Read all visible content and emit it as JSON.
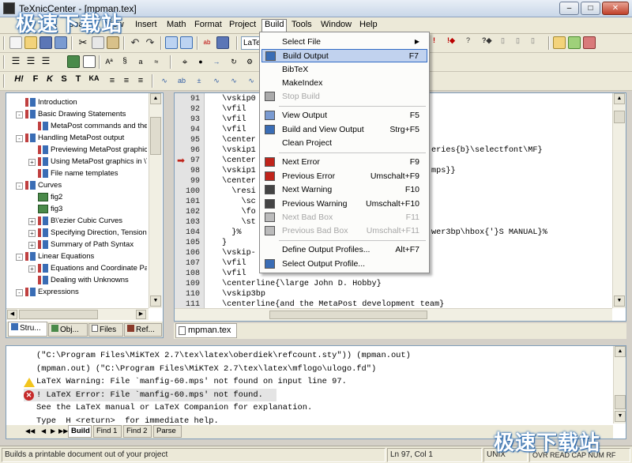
{
  "window": {
    "title": "TeXnicCenter - [mpman.tex]"
  },
  "menubar": {
    "items": [
      "File",
      "Edit",
      "Search",
      "View",
      "Insert",
      "Math",
      "Format",
      "Project",
      "Build",
      "Tools",
      "Window",
      "Help"
    ]
  },
  "toolbar": {
    "combo_text": "LaTe",
    "format_buttons": [
      "H!",
      "F",
      "K",
      "S",
      "T",
      "KA"
    ]
  },
  "watermark": {
    "text": "极速下载站"
  },
  "build_menu": {
    "items": [
      {
        "label": "Select File",
        "shortcut": "",
        "submenu": true,
        "enabled": true
      },
      {
        "label": "Build Output",
        "shortcut": "F7",
        "enabled": true,
        "highlighted": true
      },
      {
        "label": "BibTeX",
        "shortcut": "",
        "enabled": true
      },
      {
        "label": "MakeIndex",
        "shortcut": "",
        "enabled": true
      },
      {
        "label": "Stop Build",
        "shortcut": "",
        "enabled": false
      },
      {
        "label": "View Output",
        "shortcut": "F5",
        "enabled": true
      },
      {
        "label": "Build and View Output",
        "shortcut": "Strg+F5",
        "enabled": true
      },
      {
        "label": "Clean Project",
        "shortcut": "",
        "enabled": true
      },
      {
        "label": "Next Error",
        "shortcut": "F9",
        "enabled": true
      },
      {
        "label": "Previous Error",
        "shortcut": "Umschalt+F9",
        "enabled": true
      },
      {
        "label": "Next Warning",
        "shortcut": "F10",
        "enabled": true
      },
      {
        "label": "Previous Warning",
        "shortcut": "Umschalt+F10",
        "enabled": true
      },
      {
        "label": "Next Bad Box",
        "shortcut": "F11",
        "enabled": false
      },
      {
        "label": "Previous Bad Box",
        "shortcut": "Umschalt+F11",
        "enabled": false
      },
      {
        "label": "Define Output Profiles...",
        "shortcut": "Alt+F7",
        "enabled": true
      },
      {
        "label": "Select Output Profile...",
        "shortcut": "",
        "enabled": true
      }
    ]
  },
  "tree": {
    "items": [
      {
        "label": "Introduction",
        "level": 1,
        "expander": "",
        "icon": "section-icon"
      },
      {
        "label": "Basic Drawing Statements",
        "level": 1,
        "expander": "-",
        "icon": "section-icon"
      },
      {
        "label": "MetaPost commands and the re",
        "level": 2,
        "expander": "",
        "icon": "subsection-icon"
      },
      {
        "label": "Handling MetaPost output",
        "level": 1,
        "expander": "-",
        "icon": "section-icon"
      },
      {
        "label": "Previewing MetaPost graphics",
        "level": 2,
        "expander": "",
        "icon": "subsection-icon"
      },
      {
        "label": "Using MetaPost graphics in \\Te",
        "level": 2,
        "expander": "+",
        "icon": "subsection-icon"
      },
      {
        "label": "File name templates",
        "level": 2,
        "expander": "",
        "icon": "subsection-icon"
      },
      {
        "label": "Curves",
        "level": 1,
        "expander": "-",
        "icon": "section-icon"
      },
      {
        "label": "fig2",
        "level": 2,
        "expander": "",
        "icon": "figure-icon"
      },
      {
        "label": "fig3",
        "level": 2,
        "expander": "",
        "icon": "figure-icon"
      },
      {
        "label": "B\\'ezier Cubic Curves",
        "level": 2,
        "expander": "+",
        "icon": "subsection-icon"
      },
      {
        "label": "Specifying Direction, Tension, a",
        "level": 2,
        "expander": "+",
        "icon": "subsection-icon"
      },
      {
        "label": "Summary of Path Syntax",
        "level": 2,
        "expander": "+",
        "icon": "subsection-icon"
      },
      {
        "label": "Linear Equations",
        "level": 1,
        "expander": "-",
        "icon": "section-icon"
      },
      {
        "label": "Equations and Coordinate Pairs",
        "level": 2,
        "expander": "+",
        "icon": "subsection-icon"
      },
      {
        "label": "Dealing with Unknowns",
        "level": 2,
        "expander": "",
        "icon": "subsection-icon"
      },
      {
        "label": "Expressions",
        "level": 1,
        "expander": "-",
        "icon": "section-icon"
      }
    ]
  },
  "left_tabs": [
    "Stru...",
    "Obj...",
    "Files",
    "Ref..."
  ],
  "editor": {
    "tab_label": "mpman.tex",
    "lines": [
      {
        "n": "91",
        "text": "\\vskip0"
      },
      {
        "n": "92",
        "text": "\\vfil"
      },
      {
        "n": "93",
        "text": "\\vfil"
      },
      {
        "n": "94",
        "text": "\\vfil"
      },
      {
        "n": "95",
        "text": "\\center"
      },
      {
        "n": "96",
        "text": "\\vskip1"
      },
      {
        "n": "97",
        "text": "\\center"
      },
      {
        "n": "98",
        "text": "\\vskip1"
      },
      {
        "n": "99",
        "text": "\\center"
      },
      {
        "n": "100",
        "text": "  \\resi"
      },
      {
        "n": "101",
        "text": "    \\sc"
      },
      {
        "n": "102",
        "text": "    \\fo"
      },
      {
        "n": "103",
        "text": "    \\st"
      },
      {
        "n": "104",
        "text": "  }%"
      },
      {
        "n": "105",
        "text": "}"
      },
      {
        "n": "106",
        "text": "\\vskip-"
      },
      {
        "n": "107",
        "text": "\\vfil"
      },
      {
        "n": "108",
        "text": "\\vfil"
      },
      {
        "n": "109",
        "text": "\\centerline{\\large John D. Hobby}"
      },
      {
        "n": "110",
        "text": "\\vskip3bp"
      },
      {
        "n": "111",
        "text": "\\centerline{and the MetaPost development team}"
      }
    ],
    "right_fragments": [
      {
        "line": 5,
        "text": "eries{b}\\selectfont\\MF}"
      },
      {
        "line": 7,
        "text": "mps}}"
      },
      {
        "line": 13,
        "text": "wer3bp\\hbox{'}S MANUAL}%"
      }
    ]
  },
  "output": {
    "lines": [
      {
        "text": "(\"C:\\Program Files\\MiKTeX 2.7\\tex\\latex\\oberdiek\\refcount.sty\")) (mpman.out)",
        "icon": ""
      },
      {
        "text": "(mpman.out) (\"C:\\Program Files\\MiKTeX 2.7\\tex\\latex\\mflogo\\ulogo.fd\")",
        "icon": ""
      },
      {
        "text": "LaTeX Warning: File `manfig-60.mps' not found on input line 97.",
        "icon": "warning"
      },
      {
        "text": "! LaTeX Error: File `manfig-60.mps' not found.",
        "icon": "error"
      },
      {
        "text": "See the LaTeX manual or LaTeX Companion for explanation.",
        "icon": ""
      },
      {
        "text": "Type  H <return>  for immediate help.",
        "icon": ""
      }
    ],
    "tabs": [
      "Build",
      "Find 1",
      "Find 2",
      "Parse"
    ]
  },
  "statusbar": {
    "message": "Builds a printable document out of your project",
    "position": "Ln 97, Col 1",
    "encoding": "UNIX",
    "indicators": "OVR READ CAP NUM RF"
  },
  "colors": {
    "highlight": "#c1d2ee",
    "highlight_border": "#316ac5",
    "menubar": "#ece9d8",
    "watermark_outline": "#2b6fb8"
  }
}
